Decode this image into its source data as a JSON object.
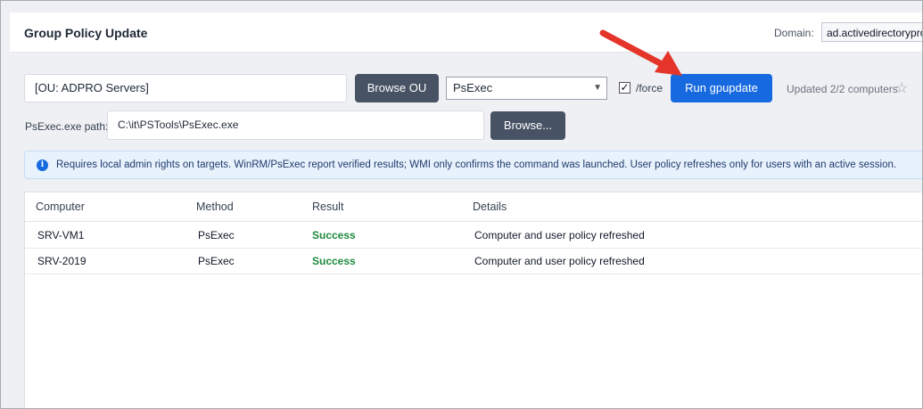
{
  "header": {
    "title": "Group Policy Update",
    "domain_label": "Domain:",
    "domain_value": "ad.activedirectorypro"
  },
  "controls": {
    "ou_value": "[OU: ADPRO Servers]",
    "browse_ou_label": "Browse OU",
    "method_value": "PsExec",
    "force_label": "/force",
    "force_checked": "✓",
    "run_label": "Run gpupdate",
    "status_text": "Updated 2/2 computers",
    "psexec_label": "PsExec.exe path:",
    "psexec_path": "C:\\it\\PSTools\\PsExec.exe",
    "browse_label": "Browse..."
  },
  "info": {
    "icon": "i",
    "text": "Requires local admin rights on targets. WinRM/PsExec report verified results; WMI only confirms the command was launched. User policy refreshes only for users with an active session."
  },
  "table": {
    "columns": [
      "Computer",
      "Method",
      "Result",
      "Details"
    ],
    "rows": [
      {
        "computer": "SRV-VM1",
        "method": "PsExec",
        "result": "Success",
        "details": "Computer and user policy refreshed"
      },
      {
        "computer": "SRV-2019",
        "method": "PsExec",
        "result": "Success",
        "details": "Computer and user policy refreshed"
      }
    ]
  },
  "colors": {
    "accent": "#1769e0",
    "success": "#1e8a3e",
    "arrow": "#e5352b",
    "dark_button": "#475264"
  },
  "icons": {
    "dropdown": "chevron-down-icon",
    "favorite": "star-icon",
    "info": "info-icon",
    "annotation": "red-arrow-annotation"
  }
}
